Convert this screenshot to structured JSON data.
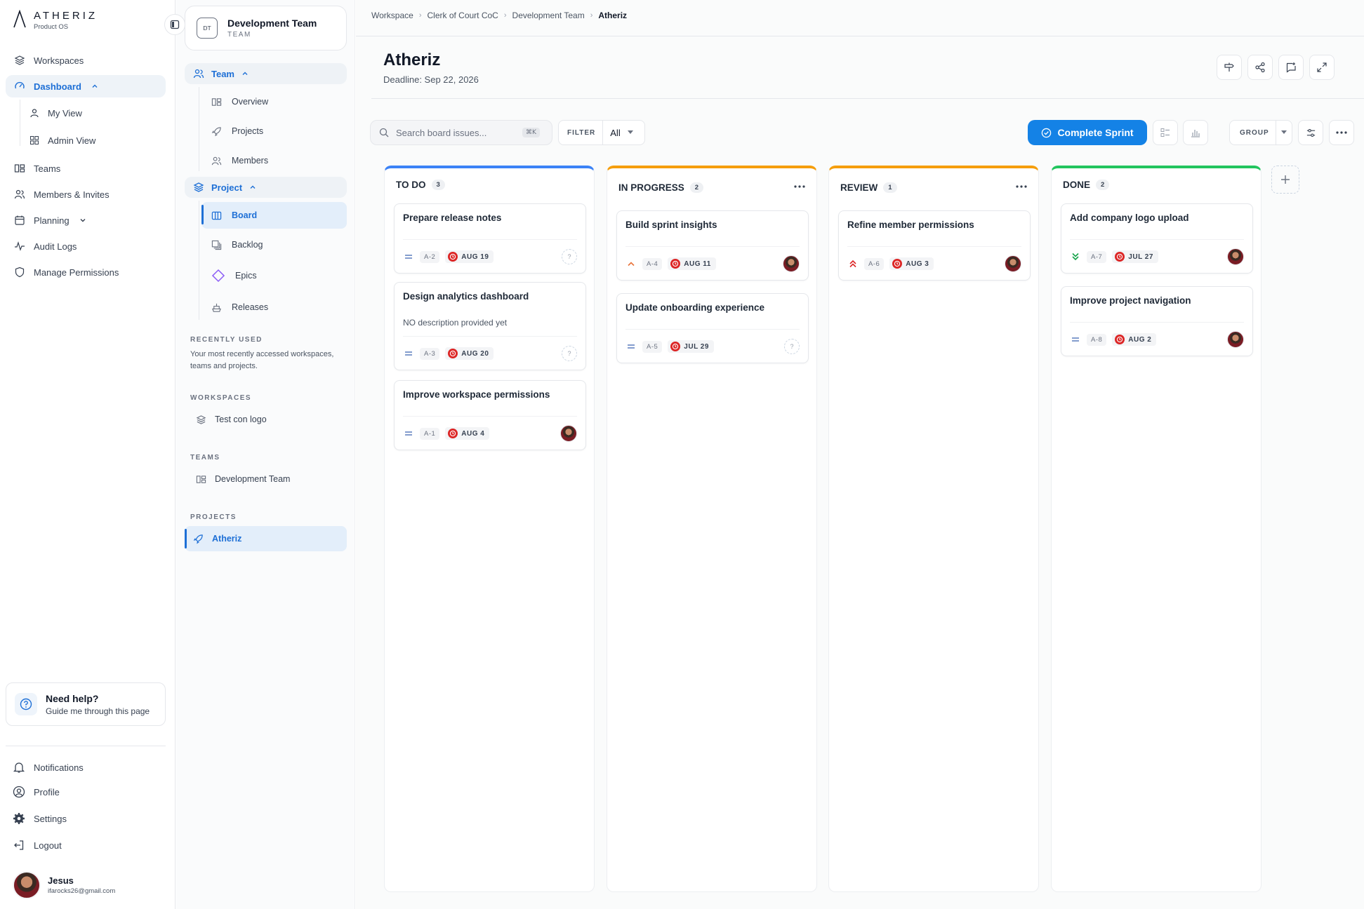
{
  "brand": {
    "name": "ATHERIZ",
    "sub": "Product OS"
  },
  "sidebar": {
    "workspaces": "Workspaces",
    "dashboard": "Dashboard",
    "my_view": "My View",
    "admin_view": "Admin View",
    "teams": "Teams",
    "members": "Members & Invites",
    "planning": "Planning",
    "audit": "Audit Logs",
    "permissions": "Manage Permissions",
    "help_title": "Need help?",
    "help_sub": "Guide me through this page",
    "notifications": "Notifications",
    "profile": "Profile",
    "settings": "Settings",
    "logout": "Logout",
    "user_name": "Jesus",
    "user_email": "ifarocks26@gmail.com"
  },
  "sidebar2": {
    "team_badge": "DT",
    "team_name": "Development Team",
    "team_type": "TEAM",
    "team_head": "Team",
    "overview": "Overview",
    "projects": "Projects",
    "members": "Members",
    "project_head": "Project",
    "board": "Board",
    "backlog": "Backlog",
    "epics": "Epics",
    "releases": "Releases",
    "recent_label": "RECENTLY USED",
    "recent_desc": "Your most recently accessed workspaces, teams and projects.",
    "ws_label": "WORKSPACES",
    "ws_item": "Test con logo",
    "teams_label": "TEAMS",
    "teams_item": "Development Team",
    "projects_label": "PROJECTS",
    "projects_item": "Atheriz"
  },
  "breadcrumb": [
    "Workspace",
    "Clerk of Court CoC",
    "Development Team",
    "Atheriz"
  ],
  "header": {
    "title": "Atheriz",
    "deadline": "Deadline: Sep 22, 2026"
  },
  "toolbar": {
    "search_placeholder": "Search board issues...",
    "shortcut": "⌘K",
    "filter_label": "FILTER",
    "filter_value": "All",
    "sprint_label": "Complete Sprint",
    "group_label": "GROUP"
  },
  "colors": {
    "accent": "#1482e6",
    "todo": "#3b82f6",
    "progress": "#f59e0b",
    "review": "#f59e0b",
    "done": "#22c55e",
    "due": "#dc2626"
  },
  "board": {
    "columns": [
      {
        "title": "TO DO",
        "count": "3",
        "cards": [
          {
            "title": "Prepare release notes",
            "key": "A-2",
            "due": "AUG 19",
            "priority": "medium",
            "assignee": false
          },
          {
            "title": "Design analytics dashboard",
            "desc": "NO description provided yet",
            "key": "A-3",
            "due": "AUG 20",
            "priority": "medium",
            "assignee": false
          },
          {
            "title": "Improve workspace permissions",
            "key": "A-1",
            "due": "AUG 4",
            "priority": "medium",
            "assignee": true
          }
        ]
      },
      {
        "title": "IN PROGRESS",
        "count": "2",
        "cards": [
          {
            "title": "Build sprint insights",
            "key": "A-4",
            "due": "AUG 11",
            "priority": "high",
            "assignee": true
          },
          {
            "title": "Update onboarding experience",
            "key": "A-5",
            "due": "JUL 29",
            "priority": "medium",
            "assignee": false
          }
        ]
      },
      {
        "title": "REVIEW",
        "count": "1",
        "cards": [
          {
            "title": "Refine member permissions",
            "key": "A-6",
            "due": "AUG 3",
            "priority": "highest",
            "assignee": true
          }
        ]
      },
      {
        "title": "DONE",
        "count": "2",
        "cards": [
          {
            "title": "Add company logo upload",
            "key": "A-7",
            "due": "JUL 27",
            "priority": "low",
            "assignee": true
          },
          {
            "title": "Improve project navigation",
            "key": "A-8",
            "due": "AUG 2",
            "priority": "medium",
            "assignee": true
          }
        ]
      }
    ]
  }
}
